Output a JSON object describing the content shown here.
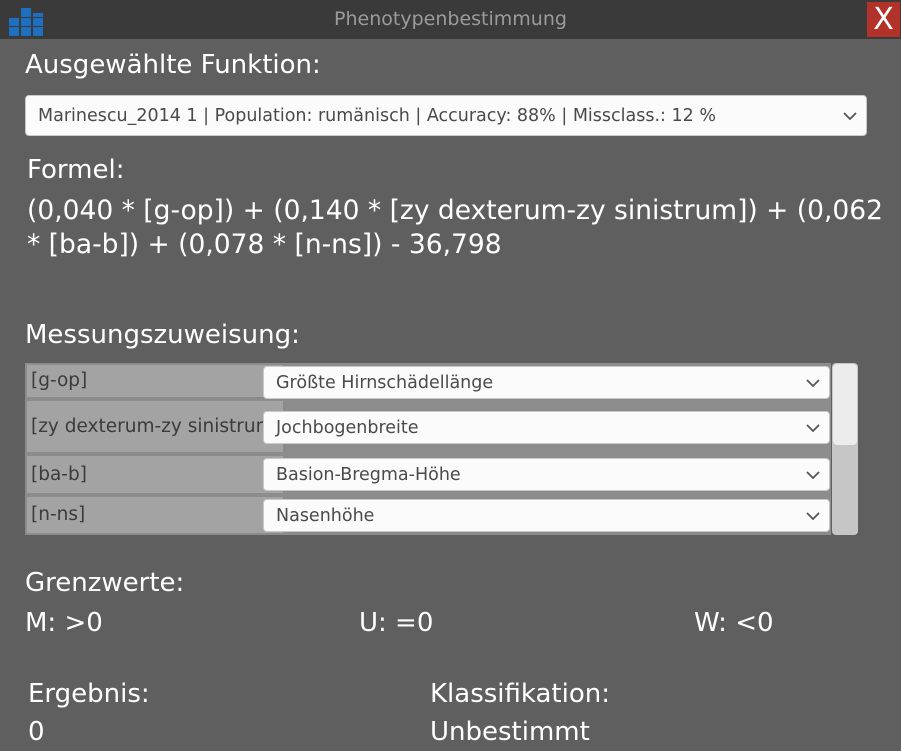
{
  "window": {
    "title": "Phenotypenbestimmung",
    "close_label": "X"
  },
  "function_section": {
    "heading": "Ausgewählte Funktion:",
    "selected": "Marinescu_2014 1 | Population: rumänisch | Accuracy: 88% | Missclass.: 12 %"
  },
  "formula_section": {
    "heading": "Formel:",
    "text": "(0,040 * [g-op]) + (0,140 * [zy dexterum-zy sinistrum]) + (0,062 * [ba-b]) + (0,078 * [n-ns]) - 36,798"
  },
  "assignment_section": {
    "heading": "Messungszuweisung:",
    "rows": [
      {
        "variable": "[g-op]",
        "measurement": "Größte Hirnschädellänge"
      },
      {
        "variable": "[zy dexterum-zy sinistrum]",
        "measurement": "Jochbogenbreite"
      },
      {
        "variable": "[ba-b]",
        "measurement": "Basion-Bregma-Höhe"
      },
      {
        "variable": "[n-ns]",
        "measurement": "Nasenhöhe"
      }
    ]
  },
  "thresholds": {
    "heading": "Grenzwerte:",
    "m": "M: >0",
    "u": "U: =0",
    "w": "W: <0"
  },
  "result": {
    "heading": "Ergebnis:",
    "value": "0"
  },
  "classification": {
    "heading": "Klassifikation:",
    "value": "Unbestimmt"
  },
  "icons": {
    "app": "bar-chart-icon",
    "dropdown": "chevron-down-icon"
  },
  "colors": {
    "background": "#5f5f5f",
    "titlebar": "#3a3a3a",
    "close": "#b23128",
    "app_icon": "#1f6fc0"
  }
}
